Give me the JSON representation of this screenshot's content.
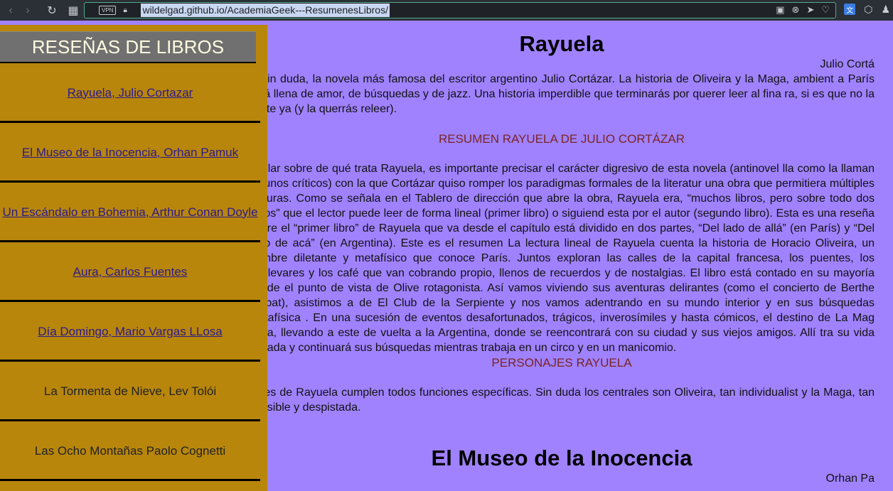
{
  "browser": {
    "vpn_label": "VPN",
    "url": "wildelgad.github.io/AcademiaGeek---ResumenesLibros/"
  },
  "sidebar": {
    "title": "RESEÑAS DE LIBROS",
    "items": [
      {
        "label": "Rayuela, Julio Cortazar",
        "link": true
      },
      {
        "label": "El Museo de la Inocencia, Orhan Pamuk",
        "link": true
      },
      {
        "label": "Un Escándalo en Bohemia, Arthur Conan Doyle",
        "link": true
      },
      {
        "label": "Aura, Carlos Fuentes",
        "link": true
      },
      {
        "label": "Día Domingo, Mario Vargas LLosa",
        "link": true
      },
      {
        "label": "La Tormenta de Nieve, Lev Tolói",
        "link": false
      },
      {
        "label": "Las Ocho Montañas Paolo Cognetti",
        "link": false
      }
    ]
  },
  "main": {
    "book1_title": "Rayuela",
    "book1_author": "Julio Cortá",
    "intro": "s, sin duda, la novela más famosa del escritor argentino Julio Cortázar. La historia de Oliveira y la Maga, ambient a París está llena de amor, de búsquedas y de jazz. Una historia imperdible que terminarás por querer leer al fina ra, si es que no la leíste ya (y la querrás releer).",
    "summary_heading": "RESUMEN RAYUELA DE JULIO CORTÁZAR",
    "summary_text": "hablar sobre de qué trata Rayuela, es importante precisar el carácter digresivo de esta novela (antinovel lla como la llaman algunos críticos) con la que Cortázar quiso romper los paradigmas formales de la literatur una obra que permitiera múltiples lecturas. Como se señala en el Tablero de dirección que abre la obra, Rayuela era, “muchos libros, pero sobre todo dos libros” que el lector puede leer de forma lineal (primer libro) o siguiend esta por el autor (segundo libro). Esta es una reseña sobre el “primer libro” de Rayuela que va desde el capítulo está dividido en dos partes, “Del lado de allá” (en París) y “Del lado de acá” (en Argentina). Este es el resumen La lectura lineal de Rayuela cuenta la historia de Horacio Oliveira, un hombre diletante y metafísico que conoce París. Juntos exploran las calles de la capital francesa, los puentes, los boulevares y los café que van cobrando propio, llenos de recuerdos y de nostalgias. El libro está contado en su mayoría desde el punto de vista de Olive rotagonista. Así vamos viviendo sus aventuras delirantes (como el concierto de Berthe Trépat), asistimos a de El Club de la Serpiente y nos vamos adentrando en su mundo interior y en sus búsquedas metafísica . En una sucesión de eventos desafortunados, trágicos, inverosímiles y hasta cómicos, el destino de La Mag mbia, llevando a este de vuelta a la Argentina, donde se reencontrará con su ciudad y sus viejos amigos. Allí tra su vida pasada y continuará sus búsquedas mientras trabaja en un circo y en un manicomio.",
    "characters_heading": "PERSONAJES RAYUELA",
    "characters_text": "najes de Rayuela cumplen todos funciones específicas. Sin duda los centrales son Oliveira, tan individualist y la Maga, tan sensible y despistada.",
    "book2_title": "El Museo de la Inocencia",
    "book2_author": "Orhan Pa"
  }
}
